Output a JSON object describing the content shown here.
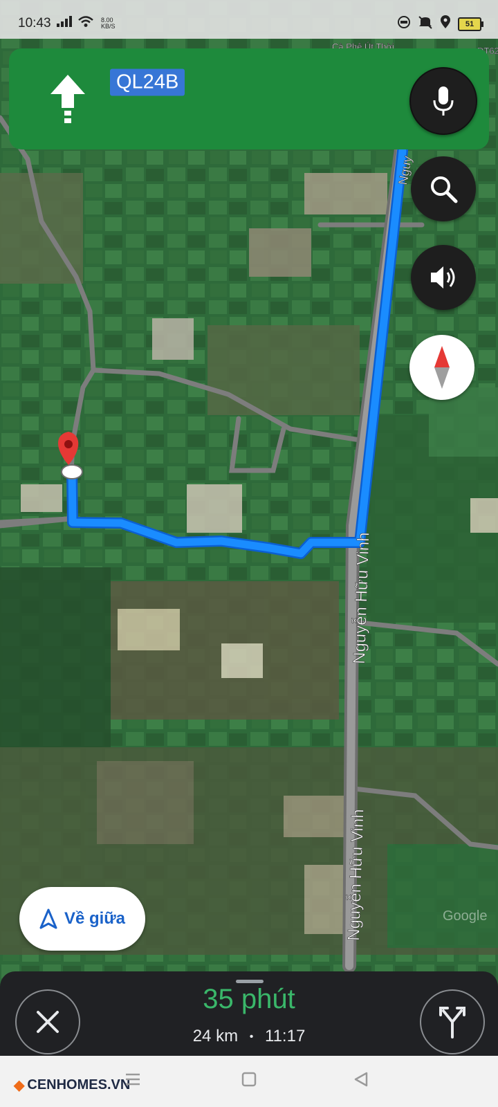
{
  "status_bar": {
    "time": "10:43",
    "net_speed_value": "8.00",
    "net_speed_unit": "KB/S",
    "battery": "51"
  },
  "map": {
    "labels": {
      "poi": "Cà Phê Út Thời",
      "road_code": "DT62",
      "street_top": "Nguy",
      "street_mid": "Nguyễn Hữu Vinh",
      "street_bottom": "Nguyễn Hữu Vinh",
      "watermark": "Google"
    },
    "colors": {
      "route": "#1a8cff",
      "road": "#8a8a8a",
      "pin": "#e53935"
    }
  },
  "nav_banner": {
    "direction_icon": "straight-arrow-icon",
    "road_name": "QL24B",
    "color": "#1e8a3c"
  },
  "controls": {
    "mic_icon": "mic-icon",
    "search_icon": "search-icon",
    "sound_icon": "speaker-icon",
    "compass_icon": "compass-icon"
  },
  "recenter": {
    "label": "Về giữa"
  },
  "trip": {
    "duration": "35 phút",
    "distance": "24 km",
    "arrival": "11:17",
    "separator": "•"
  },
  "brand": {
    "name": "CENHOMES.VN"
  }
}
